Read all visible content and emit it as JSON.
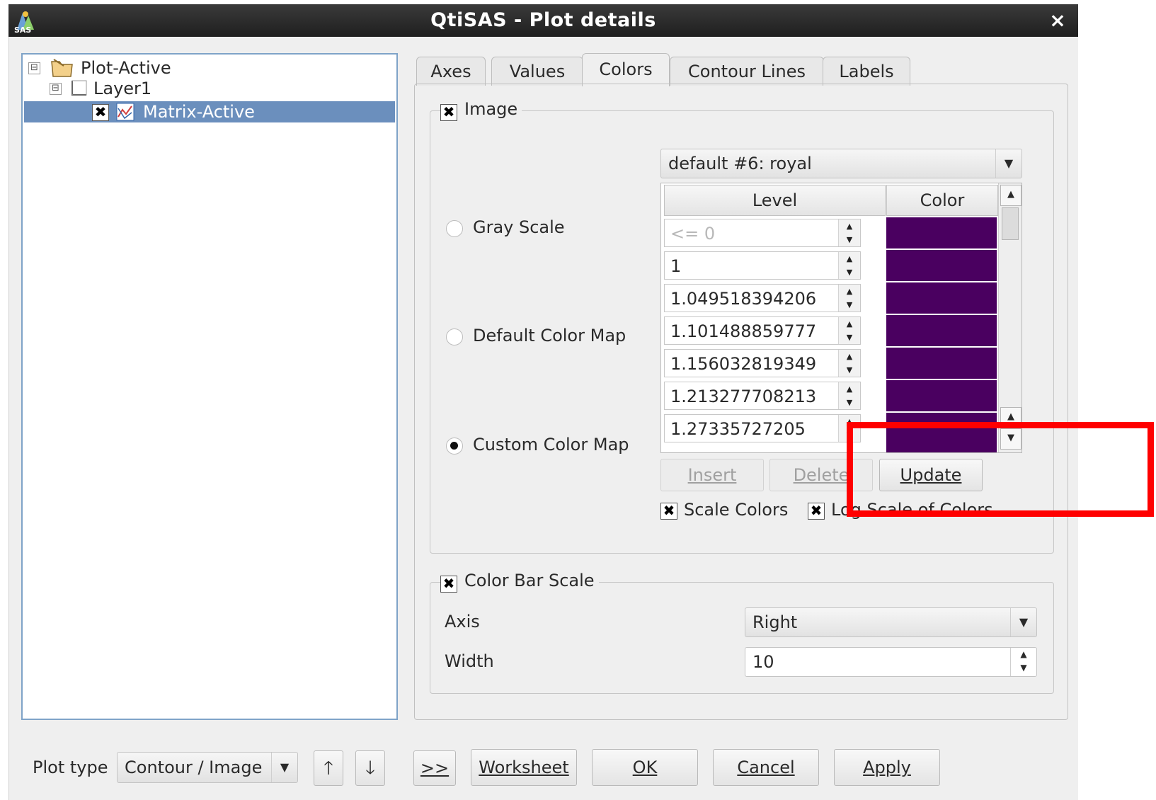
{
  "window": {
    "title": "QtiSAS - Plot details",
    "close": "×",
    "app_icon": "qtisas-logo-icon"
  },
  "tree": {
    "items": [
      {
        "label": "Plot-Active",
        "expander": "⊟"
      },
      {
        "label": "Layer1",
        "expander": "⊟"
      },
      {
        "label": "Matrix-Active",
        "checked": "✖"
      }
    ]
  },
  "tabs": [
    "Axes",
    "Values",
    "Colors",
    "Contour Lines",
    "Labels"
  ],
  "active_tab": "Colors",
  "image_group": {
    "title": "Image",
    "checked": "✖",
    "colormap_select": "default #6: royal",
    "radios": [
      {
        "label": "Gray Scale",
        "selected": false
      },
      {
        "label": "Default Color Map",
        "selected": false
      },
      {
        "label": "Custom Color Map",
        "selected": true
      }
    ],
    "table": {
      "headers": [
        "Level",
        "Color"
      ],
      "rows": [
        {
          "level": "<= 0",
          "disabled": true,
          "color": "#4a0060"
        },
        {
          "level": "1",
          "color": "#4a0060"
        },
        {
          "level": "1.049518394206",
          "color": "#4a0060"
        },
        {
          "level": "1.101488859777",
          "color": "#4a0060"
        },
        {
          "level": "1.156032819349",
          "color": "#4a0060"
        },
        {
          "level": "1.213277708213",
          "color": "#4a0060"
        },
        {
          "level": "1.27335727205",
          "color": "#4a0060"
        }
      ]
    },
    "buttons": {
      "insert": "Insert",
      "delete": "Delete",
      "update": "Update"
    },
    "scale_colors": {
      "label": "Scale Colors",
      "checked": "✖"
    },
    "log_scale": {
      "label": "Log Scale of Colors",
      "checked": "✖"
    }
  },
  "color_bar_group": {
    "title": "Color Bar Scale",
    "checked": "✖",
    "axis_label": "Axis",
    "axis_value": "Right",
    "width_label": "Width",
    "width_value": "10"
  },
  "footer": {
    "plot_type_label": "Plot type",
    "plot_type_value": "Contour / Image",
    "up": "🡑",
    "down": "🡓",
    "more": ">>",
    "worksheet": "Worksheet",
    "ok": "OK",
    "cancel": "Cancel",
    "apply": "Apply"
  },
  "colors": {
    "highlight": "#ff0000",
    "selection": "#6b8fbd",
    "swatch": "#4a0060"
  }
}
